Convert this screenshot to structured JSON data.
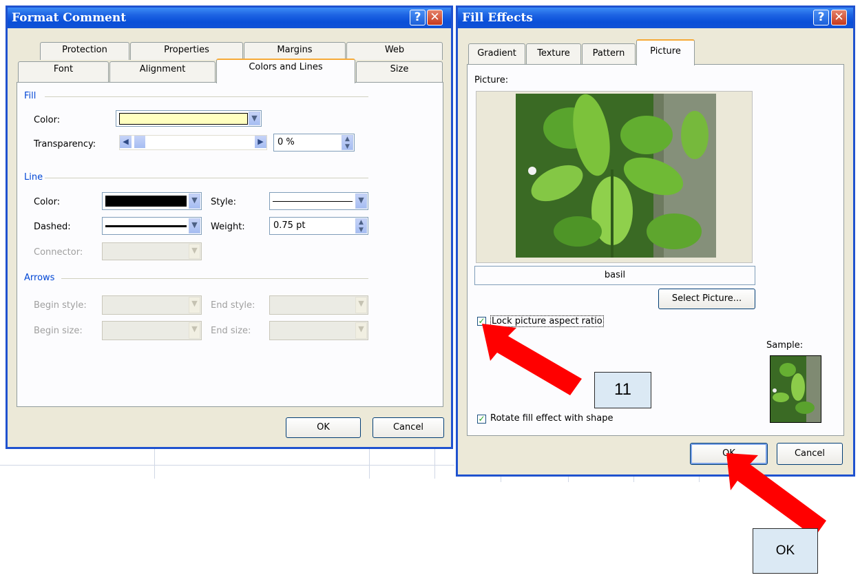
{
  "format_comment": {
    "title": "Format Comment",
    "tabs_row1": [
      "Protection",
      "Properties",
      "Margins",
      "Web"
    ],
    "tabs_row2": [
      "Font",
      "Alignment",
      "Colors and Lines",
      "Size"
    ],
    "active_tab": "Colors and Lines",
    "fill": {
      "section": "Fill",
      "color_label": "Color:",
      "color_value": "#ffffc0",
      "transparency_label": "Transparency:",
      "transparency_value": "0 %"
    },
    "line": {
      "section": "Line",
      "color_label": "Color:",
      "color_value": "#000000",
      "style_label": "Style:",
      "dashed_label": "Dashed:",
      "weight_label": "Weight:",
      "weight_value": "0.75 pt",
      "connector_label": "Connector:"
    },
    "arrows": {
      "section": "Arrows",
      "begin_style_label": "Begin style:",
      "end_style_label": "End style:",
      "begin_size_label": "Begin size:",
      "end_size_label": "End size:"
    },
    "ok_label": "OK",
    "cancel_label": "Cancel"
  },
  "fill_effects": {
    "title": "Fill Effects",
    "tabs": [
      "Gradient",
      "Texture",
      "Pattern",
      "Picture"
    ],
    "active_tab": "Picture",
    "picture_label": "Picture:",
    "picture_name": "basil",
    "select_picture_label": "Select Picture...",
    "lock_aspect_label": "Lock picture aspect ratio",
    "lock_aspect_checked": true,
    "rotate_label": "Rotate fill effect with shape",
    "rotate_checked": true,
    "sample_label": "Sample:",
    "ok_label": "OK",
    "cancel_label": "Cancel"
  },
  "callouts": {
    "step_number": "11",
    "ok_note": "OK"
  },
  "colors": {
    "title_bar": "#0a4fd8",
    "arrow": "#ff0000",
    "callout_bg": "#dbe9f4"
  }
}
